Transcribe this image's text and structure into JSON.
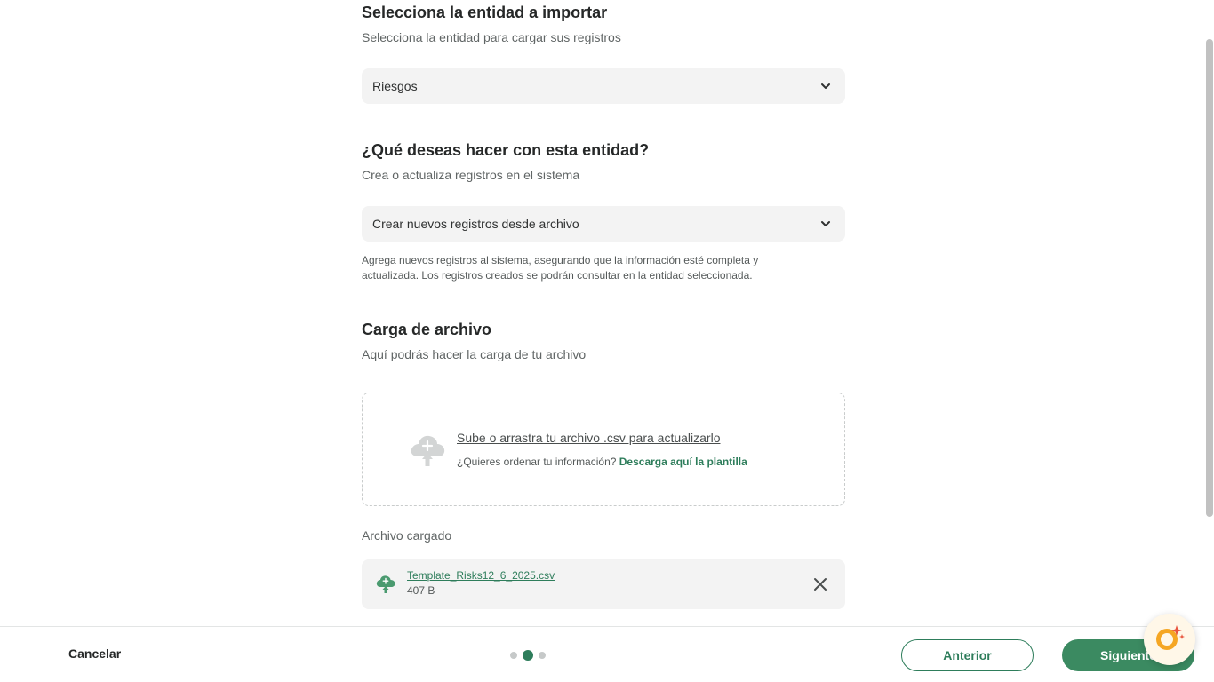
{
  "entity_section": {
    "title": "Selecciona la entidad a importar",
    "subtitle": "Selecciona la entidad para cargar sus registros",
    "selected": "Riesgos"
  },
  "action_section": {
    "title": "¿Qué deseas hacer con esta entidad?",
    "subtitle": "Crea o actualiza registros en el sistema",
    "selected": "Crear nuevos registros desde archivo",
    "help_line1": "Agrega nuevos registros al sistema, asegurando que la información esté completa y",
    "help_line2": "actualizada. Los registros creados se podrán consultar en la entidad seleccionada."
  },
  "upload_section": {
    "title": "Carga de archivo",
    "subtitle": "Aquí podrás hacer la carga de tu archivo",
    "dropzone_main": "Sube o arrastra tu archivo .csv para actualizarlo",
    "dropzone_question": "¿Quieres ordenar tu información?",
    "dropzone_link": "Descarga aquí la plantilla",
    "loaded_label": "Archivo cargado",
    "file_name": "Template_Risks12_6_2025.csv",
    "file_size": "407 B"
  },
  "footer": {
    "cancel_label": "Cancelar",
    "prev_label": "Anterior",
    "next_label": "Siguiente",
    "step_current": 2,
    "step_total": 3
  },
  "colors": {
    "accent": "#2e7d5b",
    "primary_button": "#3b8a61",
    "field_bg": "#f3f3f3"
  },
  "icons": {
    "select_chevron": "chevron-down-icon",
    "upload": "cloud-upload-icon",
    "file": "cloud-file-icon",
    "remove": "close-icon",
    "assistant": "ai-assistant-icon"
  }
}
